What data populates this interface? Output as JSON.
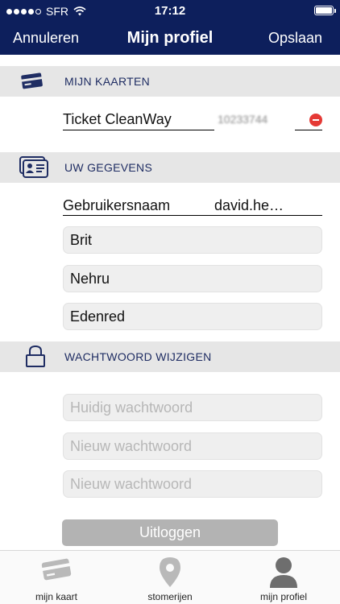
{
  "status_bar": {
    "carrier": "SFR",
    "time": "17:12"
  },
  "nav": {
    "cancel_label": "Annuleren",
    "title": "Mijn profiel",
    "save_label": "Opslaan"
  },
  "sections": {
    "cards": {
      "header": "MIJN KAARTEN",
      "icon": "credit-card-icon"
    },
    "details": {
      "header": "UW GEGEVENS",
      "icon": "id-card-icon"
    },
    "password": {
      "header": "WACHTWOORD WIJZIGEN",
      "icon": "lock-icon"
    }
  },
  "cards": [
    {
      "name": "Ticket CleanWay",
      "number": "10233744"
    }
  ],
  "details": {
    "username_label": "Gebruikersnaam",
    "username_value": "david.he…",
    "first_name": "Brit",
    "last_name": "Nehru",
    "company": "Edenred"
  },
  "password": {
    "current_placeholder": "Huidig wachtwoord",
    "new_placeholder": "Nieuw wachtwoord",
    "confirm_placeholder": "Nieuw wachtwoord"
  },
  "logout_label": "Uitloggen",
  "tabs": [
    {
      "label": "mijn kaart",
      "icon": "card-icon",
      "active": false
    },
    {
      "label": "stomerijen",
      "icon": "map-pin-icon",
      "active": false
    },
    {
      "label": "mijn profiel",
      "icon": "user-icon",
      "active": true
    }
  ],
  "colors": {
    "brand": "#0d1f5c",
    "header_bg": "#e6e6e6",
    "remove": "#e53935"
  }
}
